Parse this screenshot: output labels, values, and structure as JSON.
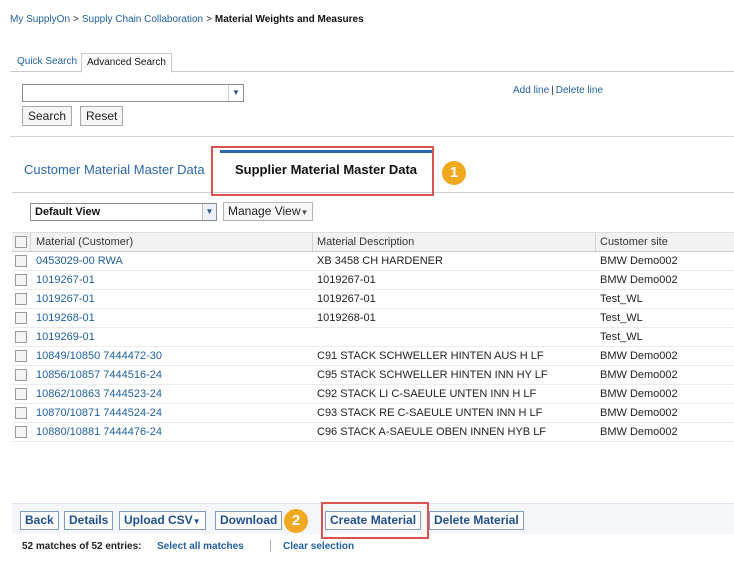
{
  "breadcrumb": {
    "items": [
      "My SupplyOn",
      "Supply Chain Collaboration"
    ],
    "separator": ">",
    "current": "Material Weights and Measures"
  },
  "search_tabs": {
    "quick": "Quick Search",
    "advanced": "Advanced Search"
  },
  "search_panel": {
    "select_value": "",
    "search_button": "Search",
    "reset_button": "Reset",
    "add_line": "Add line",
    "line_separator": "|",
    "delete_line": "Delete line"
  },
  "master_tabs": {
    "customer": "Customer Material Master Data",
    "supplier": "Supplier Material Master Data",
    "active": "supplier"
  },
  "view_controls": {
    "selected_view": "Default View",
    "manage_view": "Manage View"
  },
  "table": {
    "headers": [
      "Material (Customer)",
      "Material Description",
      "Customer site"
    ],
    "rows": [
      {
        "material": "0453029-00 RWA",
        "description": "XB 3458 CH HARDENER",
        "site": "BMW Demo002"
      },
      {
        "material": "1019267-01",
        "description": "1019267-01",
        "site": "BMW Demo002"
      },
      {
        "material": "1019267-01",
        "description": "1019267-01",
        "site": "Test_WL"
      },
      {
        "material": "1019268-01",
        "description": "1019268-01",
        "site": "Test_WL"
      },
      {
        "material": "1019269-01",
        "description": "",
        "site": "Test_WL"
      },
      {
        "material": "10849/10850 7444472-30",
        "description": "C91 STACK SCHWELLER HINTEN AUS H LF",
        "site": "BMW Demo002"
      },
      {
        "material": "10856/10857 7444516-24",
        "description": "C95 STACK SCHWELLER HINTEN INN HY LF",
        "site": "BMW Demo002"
      },
      {
        "material": "10862/10863 7444523-24",
        "description": "C92 STACK LI C-SAEULE UNTEN INN H LF",
        "site": "BMW Demo002"
      },
      {
        "material": "10870/10871 7444524-24",
        "description": "C93 STACK RE C-SAEULE UNTEN INN H LF",
        "site": "BMW Demo002"
      },
      {
        "material": "10880/10881 7444476-24",
        "description": "C96 STACK A-SAEULE OBEN INNEN HYB LF",
        "site": "BMW Demo002"
      }
    ]
  },
  "toolbar": {
    "back": "Back",
    "details": "Details",
    "upload_csv": "Upload CSV",
    "download": "Download",
    "create_material": "Create Material",
    "delete_material": "Delete Material"
  },
  "status": {
    "count": "52 matches of 52 entries:",
    "select_all": "Select all matches",
    "clear": "Clear selection"
  },
  "callouts": {
    "one": "1",
    "two": "2"
  },
  "colors": {
    "link": "#1f5f9e",
    "highlight": "#d9534f",
    "badge": "#f0a81e",
    "tab_accent": "#2b66a8"
  }
}
